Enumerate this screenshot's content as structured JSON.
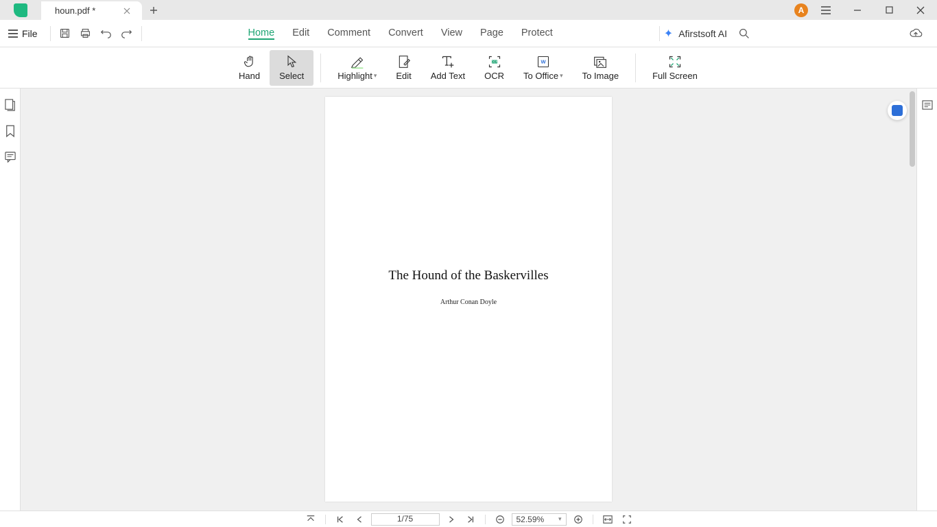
{
  "titlebar": {
    "tab_name": "houn.pdf *",
    "avatar_letter": "A"
  },
  "filebtn": {
    "label": "File"
  },
  "nav": {
    "tabs": [
      "Home",
      "Edit",
      "Comment",
      "Convert",
      "View",
      "Page",
      "Protect"
    ],
    "active": 0,
    "ai_label": "Afirstsoft AI"
  },
  "ribbon": {
    "hand": "Hand",
    "select": "Select",
    "highlight": "Highlight",
    "edit": "Edit",
    "add_text": "Add Text",
    "ocr": "OCR",
    "to_office": "To Office",
    "to_image": "To Image",
    "full_screen": "Full Screen"
  },
  "document": {
    "title": "The Hound of the Baskervilles",
    "author": "Arthur Conan Doyle"
  },
  "status": {
    "page": "1/75",
    "zoom": "52.59%"
  }
}
